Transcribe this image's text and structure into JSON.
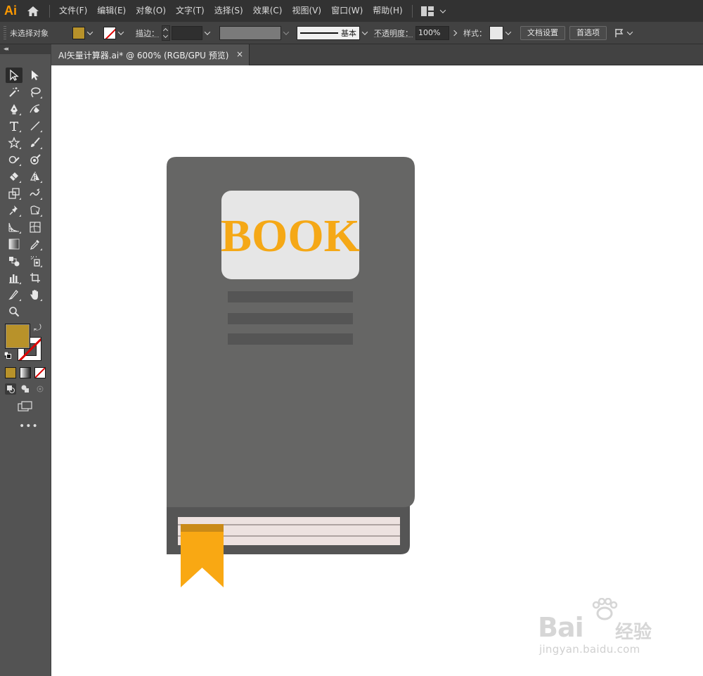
{
  "app": {
    "logo_text": "Ai",
    "menus": [
      "文件(F)",
      "编辑(E)",
      "对象(O)",
      "文字(T)",
      "选择(S)",
      "效果(C)",
      "视图(V)",
      "窗口(W)",
      "帮助(H)"
    ]
  },
  "control_bar": {
    "selection_status": "未选择对象",
    "fill_color": "#b8922a",
    "stroke_label": "描边：",
    "brush_label": "基本",
    "opacity_label": "不透明度：",
    "opacity_value": "100%",
    "style_label": "样式：",
    "document_setup_button": "文档设置",
    "preferences_button": "首选项"
  },
  "document": {
    "tab_title": "AI矢量计算器.ai* @ 600% (RGB/GPU 预览)",
    "close_glyph": "×"
  },
  "artwork": {
    "cover_color": "#666665",
    "spine_color": "#555555",
    "label_color": "#e6e6e6",
    "title_text": "BOOK",
    "title_color": "#f5a816",
    "ribbon_color": "#f9a813",
    "pages_color": "#ede2e0"
  },
  "tools": [
    "selection-tool",
    "direct-selection-tool",
    "magic-wand-tool",
    "lasso-tool",
    "pen-tool",
    "curvature-tool",
    "type-tool",
    "line-segment-tool",
    "star-tool",
    "paintbrush-tool",
    "shaper-tool",
    "blob-brush-tool",
    "eraser-tool",
    "reflect-tool",
    "scale-tool",
    "warp-tool",
    "puppet-warp-tool",
    "free-transform-tool",
    "perspective-grid-tool",
    "mesh-tool",
    "gradient-tool",
    "eyedropper-tool",
    "blend-tool",
    "symbol-sprayer-tool",
    "column-graph-tool",
    "artboard-tool",
    "slice-tool",
    "hand-tool",
    "zoom-tool"
  ],
  "fill_swatch_color": "#b8922a",
  "more_tools": "•••",
  "watermark": {
    "brand": "Bai",
    "brand_suffix": "经验",
    "url": "jingyan.baidu.com"
  }
}
